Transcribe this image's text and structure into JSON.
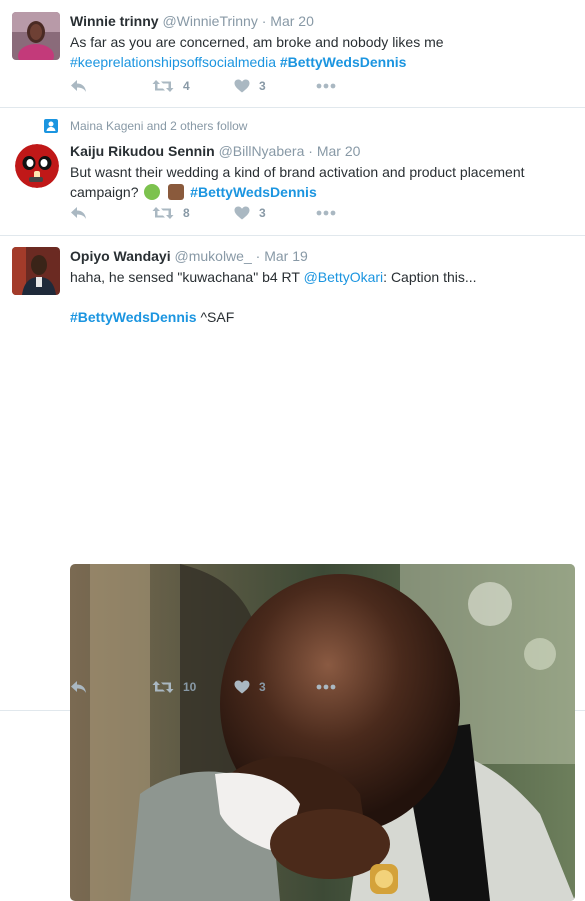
{
  "tweets": [
    {
      "name": "Winnie trinny",
      "handle": "@WinnieTrinny",
      "dot": "·",
      "time": "Mar 20",
      "line1": "As far as you are concerned, am broke and nobody likes me",
      "hashtag_a": "#keeprelationshipsoffsocialmedia",
      "hashtag_b": "#BettyWedsDennis",
      "retweets": "4",
      "likes": "3"
    },
    {
      "context": "Maina Kageni and 2 others follow",
      "name": "Kaiju Rikudou Sennin",
      "handle": "@BillNyabera",
      "dot": "·",
      "time": "Mar 20",
      "line1": "But wasnt their wedding a kind of brand activation and product placement",
      "line2": "campaign?",
      "hashtag": "#BettyWedsDennis",
      "retweets": "8",
      "likes": "3"
    },
    {
      "name": "Opiyo Wandayi",
      "handle": "@mukolwe_",
      "dot": "·",
      "time": "Mar 19",
      "line1_pre": "haha, he sensed \"kuwachana\" b4 RT",
      "mention": "@BettyOkari",
      "line1_post": ": Caption this...",
      "hashtag": "#BettyWedsDennis",
      "suffix": " ^SAF",
      "retweets": "10",
      "likes": "3"
    }
  ],
  "icons": {
    "reply": "reply-icon",
    "retweet": "retweet-icon",
    "like": "heart-icon",
    "more": "more-icon",
    "follow": "person-icon"
  },
  "colors": {
    "link": "#1b95e0",
    "muted": "#8899a6",
    "text": "#292f33",
    "divider": "#e1e8ed"
  }
}
